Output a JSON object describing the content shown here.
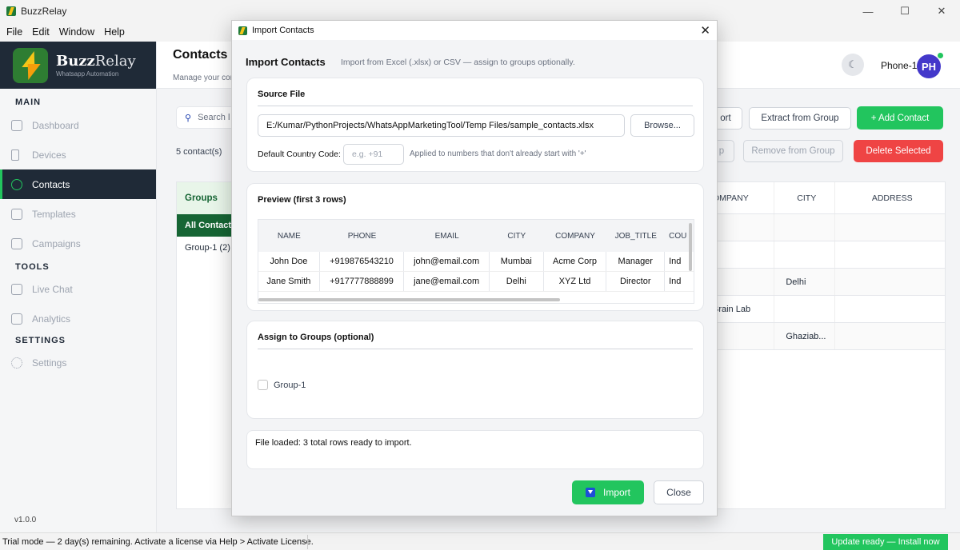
{
  "window": {
    "title": "BuzzRelay",
    "controls": [
      "—",
      "☐",
      "✕"
    ]
  },
  "menu": [
    "File",
    "Edit",
    "Window",
    "Help"
  ],
  "sidebar": {
    "brand_name_1": "Buzz",
    "brand_name_2": "Relay",
    "brand_sub": "Whatsapp Automation",
    "sections": {
      "main": "MAIN",
      "tools": "TOOLS",
      "settings": "SETTINGS"
    },
    "items": {
      "dashboard": "Dashboard",
      "devices": "Devices",
      "contacts": "Contacts",
      "templates": "Templates",
      "campaigns": "Campaigns",
      "live_chat": "Live Chat",
      "analytics": "Analytics",
      "settings": "Settings"
    },
    "version": "v1.0.0"
  },
  "header": {
    "title": "Contacts",
    "subtitle": "Manage your con",
    "theme_icon": "☾",
    "phone": "Phone-1",
    "avatar": "PH"
  },
  "toolbar": {
    "search_placeholder": "Search l",
    "count": "5 contact(s)",
    "import_partial": "ort",
    "extract": "Extract from Group",
    "add": "+ Add Contact",
    "add_to_group_partial": "p",
    "remove_from_group": "Remove from Group",
    "delete_selected": "Delete Selected"
  },
  "groups": {
    "title": "Groups",
    "items": [
      "All Contacts",
      "Group-1  (2)"
    ]
  },
  "contacts_table": {
    "headers": [
      "OMPANY",
      "CITY",
      "ADDRESS"
    ],
    "rows": [
      [
        "",
        "",
        ""
      ],
      [
        "",
        "",
        ""
      ],
      [
        "",
        "Delhi",
        ""
      ],
      [
        "Brain Lab",
        "",
        ""
      ],
      [
        "",
        "Ghaziab...",
        ""
      ]
    ]
  },
  "statusbar": {
    "text": "Trial mode — 2 day(s) remaining. Activate a license via Help > Activate License.",
    "update": "Update ready — Install now"
  },
  "dialog": {
    "window_title": "Import Contacts",
    "heading": "Import Contacts",
    "subheading": "Import from Excel (.xlsx) or CSV — assign to groups optionally.",
    "source": {
      "title": "Source File",
      "path": "E:/Kumar/PythonProjects/WhatsAppMarketingTool/Temp Files/sample_contacts.xlsx",
      "browse": "Browse...",
      "cc_label": "Default Country Code:",
      "cc_placeholder": "e.g. +91",
      "cc_hint": "Applied to numbers that don't already start with '+'"
    },
    "preview": {
      "title": "Preview  (first 3 rows)",
      "headers": [
        "NAME",
        "PHONE",
        "EMAIL",
        "CITY",
        "COMPANY",
        "JOB_TITLE",
        "COU"
      ],
      "rows": [
        [
          "John Doe",
          "+919876543210",
          "john@email.com",
          "Mumbai",
          "Acme Corp",
          "Manager",
          "Ind"
        ],
        [
          "Jane Smith",
          "+917777888899",
          "jane@email.com",
          "Delhi",
          "XYZ Ltd",
          "Director",
          "Ind"
        ]
      ]
    },
    "groups": {
      "title": "Assign to Groups  (optional)",
      "options": [
        "Group-1"
      ]
    },
    "status": "File loaded: 3 total rows ready to import.",
    "import_button": "Import",
    "close_button": "Close"
  }
}
